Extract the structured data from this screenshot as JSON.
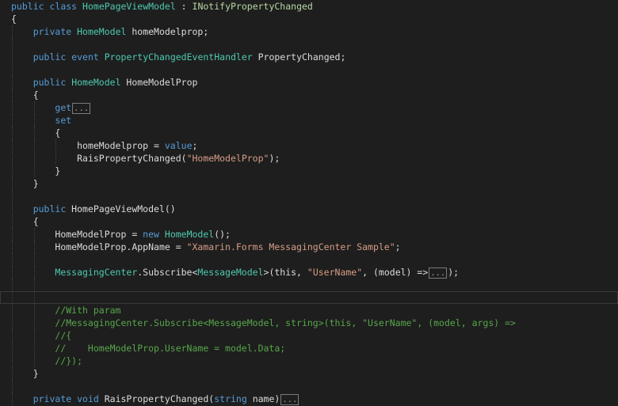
{
  "editor": {
    "lines": [
      {
        "indent": 0,
        "tokens": [
          {
            "t": "public",
            "c": "kw"
          },
          {
            "t": " "
          },
          {
            "t": "class",
            "c": "kw"
          },
          {
            "t": " "
          },
          {
            "t": "HomePageViewModel",
            "c": "type"
          },
          {
            "t": " : "
          },
          {
            "t": "INotifyPropertyChanged",
            "c": "iface"
          }
        ]
      },
      {
        "indent": 0,
        "tokens": [
          {
            "t": "{"
          }
        ]
      },
      {
        "indent": 1,
        "tokens": [
          {
            "t": "private",
            "c": "kw"
          },
          {
            "t": " "
          },
          {
            "t": "HomeModel",
            "c": "type"
          },
          {
            "t": " homeModelprop;"
          }
        ]
      },
      {
        "indent": 1,
        "tokens": []
      },
      {
        "indent": 1,
        "tokens": [
          {
            "t": "public",
            "c": "kw"
          },
          {
            "t": " "
          },
          {
            "t": "event",
            "c": "kw"
          },
          {
            "t": " "
          },
          {
            "t": "PropertyChangedEventHandler",
            "c": "type"
          },
          {
            "t": " PropertyChanged;"
          }
        ]
      },
      {
        "indent": 1,
        "tokens": []
      },
      {
        "indent": 1,
        "tokens": [
          {
            "t": "public",
            "c": "kw"
          },
          {
            "t": " "
          },
          {
            "t": "HomeModel",
            "c": "type"
          },
          {
            "t": " HomeModelProp"
          }
        ]
      },
      {
        "indent": 1,
        "tokens": [
          {
            "t": "{"
          }
        ]
      },
      {
        "indent": 2,
        "tokens": [
          {
            "t": "get",
            "c": "kw"
          },
          {
            "t": "...",
            "c": "fold",
            "fold": true
          }
        ]
      },
      {
        "indent": 2,
        "tokens": [
          {
            "t": "set",
            "c": "kw"
          }
        ]
      },
      {
        "indent": 2,
        "tokens": [
          {
            "t": "{"
          }
        ]
      },
      {
        "indent": 3,
        "tokens": [
          {
            "t": "homeModelprop = "
          },
          {
            "t": "value",
            "c": "kw"
          },
          {
            "t": ";"
          }
        ]
      },
      {
        "indent": 3,
        "tokens": [
          {
            "t": "RaisPropertyChanged("
          },
          {
            "t": "\"HomeModelProp\"",
            "c": "str"
          },
          {
            "t": ");"
          }
        ]
      },
      {
        "indent": 2,
        "tokens": [
          {
            "t": "}"
          }
        ]
      },
      {
        "indent": 1,
        "tokens": [
          {
            "t": "}"
          }
        ]
      },
      {
        "indent": 1,
        "tokens": []
      },
      {
        "indent": 1,
        "tokens": [
          {
            "t": "public",
            "c": "kw"
          },
          {
            "t": " HomePageViewModel()"
          }
        ]
      },
      {
        "indent": 1,
        "tokens": [
          {
            "t": "{"
          }
        ]
      },
      {
        "indent": 2,
        "tokens": [
          {
            "t": "HomeModelProp = "
          },
          {
            "t": "new",
            "c": "kw"
          },
          {
            "t": " "
          },
          {
            "t": "HomeModel",
            "c": "type"
          },
          {
            "t": "();"
          }
        ]
      },
      {
        "indent": 2,
        "tokens": [
          {
            "t": "HomeModelProp.AppName = "
          },
          {
            "t": "\"Xamarin.Forms MessagingCenter Sample\"",
            "c": "str"
          },
          {
            "t": ";"
          }
        ]
      },
      {
        "indent": 2,
        "tokens": []
      },
      {
        "indent": 2,
        "tokens": [
          {
            "t": "MessagingCenter",
            "c": "type"
          },
          {
            "t": ".Subscribe<"
          },
          {
            "t": "MessageModel",
            "c": "type"
          },
          {
            "t": ">(this, "
          },
          {
            "t": "\"UserName\"",
            "c": "str"
          },
          {
            "t": ", (model) =>"
          },
          {
            "t": "...",
            "c": "fold",
            "fold": true
          },
          {
            "t": ");"
          }
        ]
      },
      {
        "indent": 2,
        "tokens": []
      },
      {
        "indent": 2,
        "current": true,
        "tokens": []
      },
      {
        "indent": 2,
        "tokens": [
          {
            "t": "//With param",
            "c": "cmt"
          }
        ]
      },
      {
        "indent": 2,
        "tokens": [
          {
            "t": "//MessagingCenter.Subscribe<MessageModel, string>(this, \"UserName\", (model, args) =>",
            "c": "cmt"
          }
        ]
      },
      {
        "indent": 2,
        "tokens": [
          {
            "t": "//{",
            "c": "cmt"
          }
        ]
      },
      {
        "indent": 2,
        "tokens": [
          {
            "t": "//    HomeModelProp.UserName = model.Data;",
            "c": "cmt"
          }
        ]
      },
      {
        "indent": 2,
        "tokens": [
          {
            "t": "//});",
            "c": "cmt"
          }
        ]
      },
      {
        "indent": 1,
        "tokens": [
          {
            "t": "}"
          }
        ]
      },
      {
        "indent": 1,
        "tokens": []
      },
      {
        "indent": 1,
        "tokens": [
          {
            "t": "private",
            "c": "kw"
          },
          {
            "t": " "
          },
          {
            "t": "void",
            "c": "kw"
          },
          {
            "t": " RaisPropertyChanged("
          },
          {
            "t": "string",
            "c": "kw"
          },
          {
            "t": " name)"
          },
          {
            "t": "...",
            "c": "fold",
            "fold": true
          }
        ]
      }
    ]
  }
}
